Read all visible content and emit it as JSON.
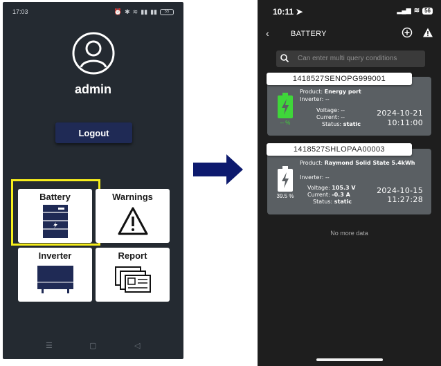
{
  "left_screen": {
    "status_bar": {
      "time": "17:03",
      "battery": "55"
    },
    "username": "admin",
    "logout_label": "Logout",
    "tiles": {
      "battery": "Battery",
      "warnings": "Warnings",
      "inverter": "Inverter",
      "report": "Report"
    },
    "highlight_color": "#f6ee1c"
  },
  "right_screen": {
    "status_bar": {
      "time": "10:11",
      "battery": "56"
    },
    "header": {
      "title": "BATTERY"
    },
    "search": {
      "placeholder": "Can enter multi query conditions"
    },
    "cards": [
      {
        "id": "1418527SENOPG999001",
        "product_label": "Product:",
        "product": "Energy port",
        "inverter_label": "Inverter:",
        "inverter": "--",
        "voltage_label": "Voltage:",
        "voltage": "--",
        "current_label": "Current:",
        "current": "--",
        "status_label": "Status:",
        "status": "static",
        "percent": "-- %",
        "date": "2024-10-21",
        "time": "10:11:00",
        "battery_color": "#3fd63a"
      },
      {
        "id": "1418527SHLOPAA00003",
        "product_label": "Product:",
        "product": "Raymond Solid State 5.4kWh",
        "inverter_label": "Inverter:",
        "inverter": "--",
        "voltage_label": "Voltage:",
        "voltage": "105.3 V",
        "current_label": "Current:",
        "current": "-0.3 A",
        "status_label": "Status:",
        "status": "static",
        "percent": "39.5 %",
        "date": "2024-10-15",
        "time": "11:27:28",
        "battery_color": "#ffffff"
      }
    ],
    "no_more_text": "No more data"
  },
  "colors": {
    "left_bg": "#242a31",
    "right_bg": "#1e1e1e",
    "logout_button": "#1f2a55",
    "arrow": "#0d1a6e"
  }
}
